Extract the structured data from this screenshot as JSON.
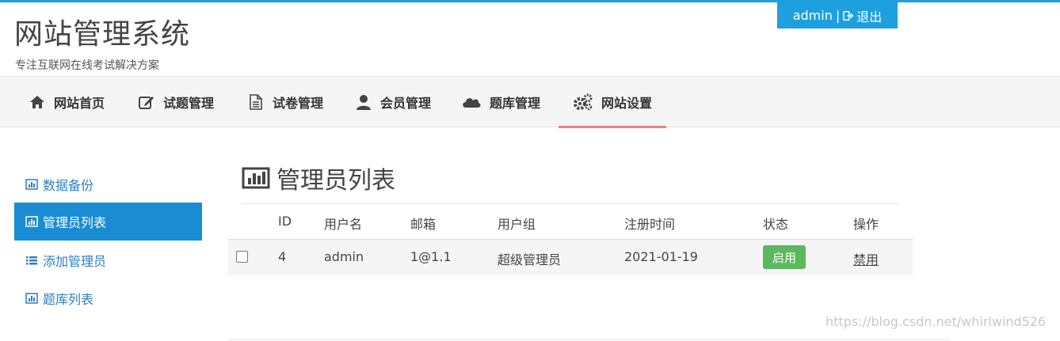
{
  "header": {
    "title": "网站管理系统",
    "subtitle": "专注互联网在线考试解决方案",
    "user": "admin",
    "separator": "|",
    "logout_label": "退出"
  },
  "nav": {
    "items": [
      {
        "label": "网站首页",
        "icon": "home-icon"
      },
      {
        "label": "试题管理",
        "icon": "edit-icon"
      },
      {
        "label": "试卷管理",
        "icon": "file-icon"
      },
      {
        "label": "会员管理",
        "icon": "user-icon"
      },
      {
        "label": "题库管理",
        "icon": "cloud-icon"
      },
      {
        "label": "网站设置",
        "icon": "gears-icon"
      }
    ],
    "active": "网站设置"
  },
  "sidebar": {
    "items": [
      {
        "label": "数据备份",
        "icon": "bar-chart-icon"
      },
      {
        "label": "管理员列表",
        "icon": "bar-chart-icon"
      },
      {
        "label": "添加管理员",
        "icon": "list-icon"
      },
      {
        "label": "题库列表",
        "icon": "bar-chart-icon"
      }
    ],
    "active": "管理员列表"
  },
  "main": {
    "title": "管理员列表",
    "table": {
      "headers": [
        "ID",
        "用户名",
        "邮箱",
        "用户组",
        "注册时间",
        "状态",
        "操作"
      ],
      "rows": [
        {
          "id": "4",
          "username": "admin",
          "email": "1@1.1",
          "group": "超级管理员",
          "registered": "2021-01-19",
          "status": "启用",
          "action": "禁用"
        }
      ]
    }
  },
  "colors": {
    "accent": "#1e9fde",
    "sidebar_active": "#1a8cd3",
    "status_green": "#5cb85c",
    "nav_active_underline": "#f08080",
    "link_blue": "#2d7fc2"
  },
  "watermark": "https://blog.csdn.net/whirlwind526"
}
